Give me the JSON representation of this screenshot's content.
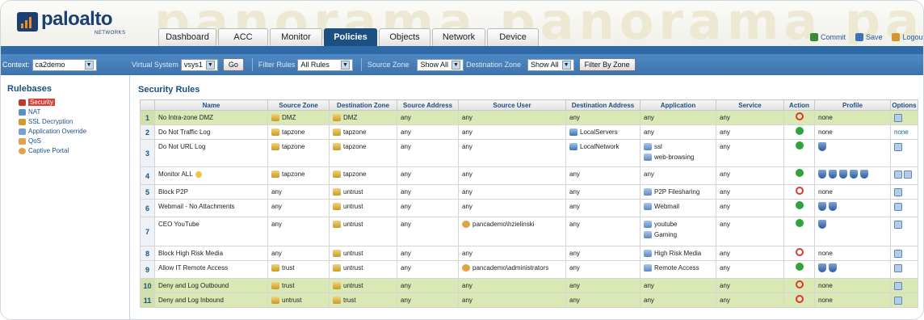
{
  "app": {
    "logo_text": "paloalto",
    "logo_sub": "NETWORKS",
    "watermark": "panorama panorama pano"
  },
  "tabs": [
    "Dashboard",
    "ACC",
    "Monitor",
    "Policies",
    "Objects",
    "Network",
    "Device"
  ],
  "active_tab": "Policies",
  "top_links": [
    "Commit",
    "Save",
    "Logout"
  ],
  "toolbar": {
    "context_label": "Context:",
    "context_value": "ca2demo",
    "vsys_label": "Virtual System",
    "vsys_value": "vsys1",
    "go_label": "Go",
    "filter_label": "Filter Rules",
    "filter_value": "All Rules",
    "src_zone_label": "Source Zone",
    "src_zone_value": "Show All",
    "dst_zone_label": "Destination Zone",
    "dst_zone_value": "Show All",
    "filter_zone_btn": "Filter By Zone"
  },
  "sidebar": {
    "title": "Rulebases",
    "items": [
      "Security",
      "NAT",
      "SSL Decryption",
      "Application Override",
      "QoS",
      "Captive Portal"
    ]
  },
  "main": {
    "title": "Security Rules",
    "columns": [
      "",
      "Name",
      "Source Zone",
      "Destination Zone",
      "Source Address",
      "Source User",
      "Destination Address",
      "Application",
      "Service",
      "Action",
      "Profile",
      "Options"
    ],
    "rows": [
      {
        "num": "1",
        "name": "No Intra-zone DMZ",
        "src_zone": "DMZ",
        "dst_zone": "DMZ",
        "src_addr": "any",
        "src_user": "any",
        "dst_addr": "any",
        "apps": [
          "any"
        ],
        "service": "any",
        "action": "deny",
        "profile": "none",
        "options": "icon",
        "hl": true
      },
      {
        "num": "2",
        "name": "Do Not Traffic Log",
        "src_zone": "tapzone",
        "dst_zone": "tapzone",
        "src_addr": "any",
        "src_user": "any",
        "dst_addr": "LocalServers",
        "apps": [
          "any"
        ],
        "service": "any",
        "action": "allow",
        "profile": "none",
        "options": "none",
        "hl": false
      },
      {
        "num": "3",
        "name": "Do Not URL Log",
        "src_zone": "tapzone",
        "dst_zone": "tapzone",
        "src_addr": "any",
        "src_user": "any",
        "dst_addr": "LocalNetwork",
        "apps": [
          "ssl",
          "web-browsing"
        ],
        "service": "any",
        "action": "allow",
        "profile": "icons1",
        "options": "icon",
        "hl": false
      },
      {
        "num": "4",
        "name": "Monitor ALL",
        "src_zone": "tapzone",
        "dst_zone": "tapzone",
        "src_addr": "any",
        "src_user": "any",
        "dst_addr": "any",
        "apps": [
          "any"
        ],
        "service": "any",
        "action": "allow",
        "profile": "icons5",
        "options": "icon2",
        "hl": false
      },
      {
        "num": "5",
        "name": "Block P2P",
        "src_zone": "any",
        "dst_zone": "untrust",
        "src_addr": "any",
        "src_user": "any",
        "dst_addr": "any",
        "apps": [
          "P2P Filesharing"
        ],
        "service": "any",
        "action": "deny",
        "profile": "none",
        "options": "icon",
        "hl": false
      },
      {
        "num": "6",
        "name": "Webmail - No Attachments",
        "src_zone": "any",
        "dst_zone": "untrust",
        "src_addr": "any",
        "src_user": "any",
        "dst_addr": "any",
        "apps": [
          "Webmail"
        ],
        "service": "any",
        "action": "allow",
        "profile": "icons2",
        "options": "icon",
        "hl": false
      },
      {
        "num": "7",
        "name": "CEO YouTube",
        "src_zone": "any",
        "dst_zone": "untrust",
        "src_addr": "any",
        "src_user": "pancademo\\hzielinski",
        "dst_addr": "any",
        "apps": [
          "youtube",
          "Gaming"
        ],
        "service": "any",
        "action": "allow",
        "profile": "icons1",
        "options": "icon",
        "hl": false
      },
      {
        "num": "8",
        "name": "Block High Risk Media",
        "src_zone": "any",
        "dst_zone": "untrust",
        "src_addr": "any",
        "src_user": "any",
        "dst_addr": "any",
        "apps": [
          "High Risk Media"
        ],
        "service": "any",
        "action": "deny",
        "profile": "none",
        "options": "icon",
        "hl": false
      },
      {
        "num": "9",
        "name": "Allow IT Remote Access",
        "src_zone": "trust",
        "dst_zone": "untrust",
        "src_addr": "any",
        "src_user": "pancademo\\administrators",
        "dst_addr": "any",
        "apps": [
          "Remote Access"
        ],
        "service": "any",
        "action": "allow",
        "profile": "icons2",
        "options": "icon",
        "hl": false
      },
      {
        "num": "10",
        "name": "Deny and Log Outbound",
        "src_zone": "trust",
        "dst_zone": "untrust",
        "src_addr": "any",
        "src_user": "any",
        "dst_addr": "any",
        "apps": [
          "any"
        ],
        "service": "any",
        "action": "deny",
        "profile": "none",
        "options": "icon",
        "hl": true
      },
      {
        "num": "11",
        "name": "Deny and Log Inbound",
        "src_zone": "untrust",
        "dst_zone": "trust",
        "src_addr": "any",
        "src_user": "any",
        "dst_addr": "any",
        "apps": [
          "any"
        ],
        "service": "any",
        "action": "deny",
        "profile": "none",
        "options": "icon",
        "hl": true
      }
    ]
  },
  "colors": {
    "brand_blue": "#1c4f82",
    "highlight_row": "#d9e8b5",
    "allow": "#2fa43a",
    "deny": "#d93a2f"
  }
}
